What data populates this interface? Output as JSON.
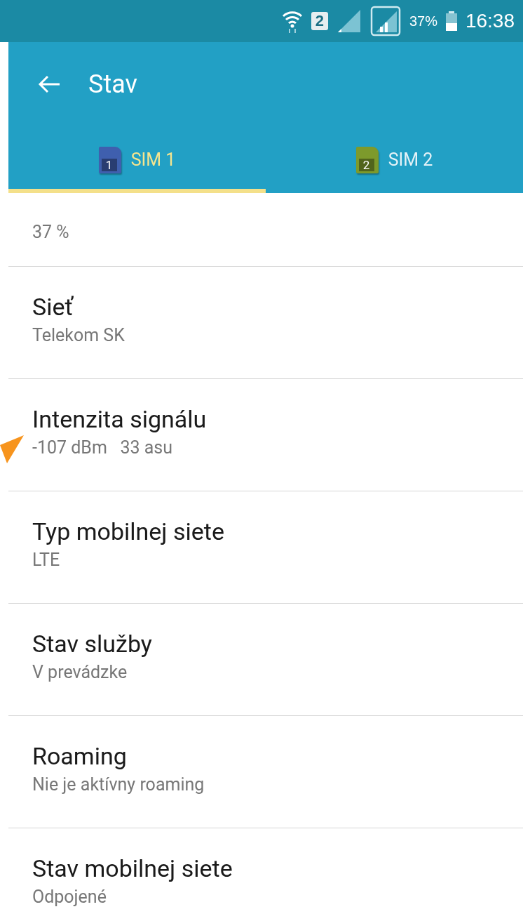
{
  "status_bar": {
    "sim_badge": "2",
    "battery_text": "37%",
    "time": "16:38"
  },
  "app_bar": {
    "title": "Stav"
  },
  "tabs": [
    {
      "label": "SIM 1",
      "badge": "1",
      "color": "#3f5fae",
      "selected": true
    },
    {
      "label": "SIM 2",
      "badge": "2",
      "color": "#7d9a2c",
      "selected": false
    }
  ],
  "items": [
    {
      "value": "37 %"
    },
    {
      "title": "Sieť",
      "value": "Telekom SK"
    },
    {
      "title": "Intenzita signálu",
      "value": "-107 dBm   33 asu"
    },
    {
      "title": "Typ mobilnej siete",
      "value": "LTE"
    },
    {
      "title": "Stav služby",
      "value": "V prevádzke"
    },
    {
      "title": "Roaming",
      "value": "Nie je aktívny roaming"
    },
    {
      "title": "Stav mobilnej siete",
      "value": "Odpojené"
    }
  ]
}
